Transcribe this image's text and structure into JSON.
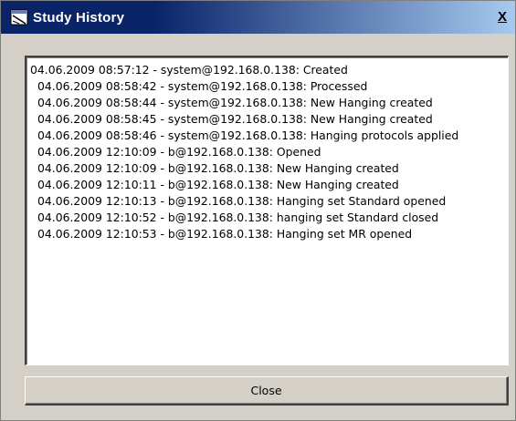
{
  "window": {
    "title": "Study History",
    "close_glyph": "X"
  },
  "log": {
    "entries": [
      "04.06.2009 08:57:12 - system@192.168.0.138: Created",
      "04.06.2009 08:58:42 - system@192.168.0.138: Processed",
      "04.06.2009 08:58:44 - system@192.168.0.138: New Hanging created",
      "04.06.2009 08:58:45 - system@192.168.0.138: New Hanging created",
      "04.06.2009 08:58:46 - system@192.168.0.138: Hanging protocols applied",
      "04.06.2009 12:10:09 - b@192.168.0.138: Opened",
      "04.06.2009 12:10:09 - b@192.168.0.138: New Hanging created",
      "04.06.2009 12:10:11 - b@192.168.0.138: New Hanging created",
      "04.06.2009 12:10:13 - b@192.168.0.138: Hanging set Standard opened",
      "04.06.2009 12:10:52 - b@192.168.0.138: hanging set Standard closed",
      "04.06.2009 12:10:53 - b@192.168.0.138: Hanging set MR opened"
    ]
  },
  "footer": {
    "close_label": "Close"
  },
  "icons": {
    "title_icon": "app-window-icon"
  }
}
